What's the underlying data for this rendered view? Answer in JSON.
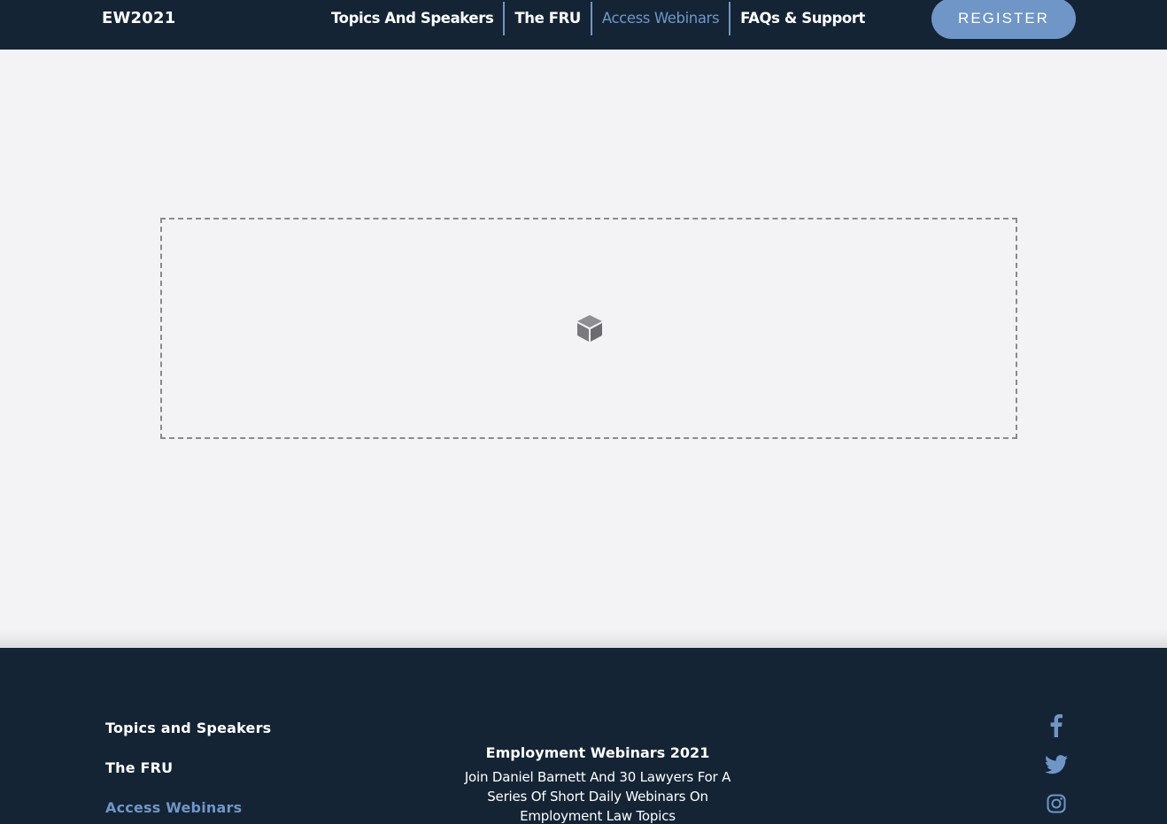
{
  "header": {
    "logo": "EW2021",
    "nav": [
      {
        "label": "Topics And Speakers"
      },
      {
        "label": "The FRU"
      },
      {
        "label": "Access Webinars",
        "active": true
      },
      {
        "label": "FAQs & Support"
      }
    ],
    "register_label": "REGISTER"
  },
  "main": {
    "placeholder_icon": "cube-icon"
  },
  "footer": {
    "links": [
      {
        "label": "Topics and Speakers"
      },
      {
        "label": "The FRU"
      },
      {
        "label": "Access Webinars",
        "active": true
      }
    ],
    "title": "Employment Webinars 2021",
    "description": "Join Daniel Barnett And 30 Lawyers For A Series Of Short Daily Webinars On Employment Law Topics",
    "social_icons": [
      "facebook-icon",
      "twitter-icon",
      "instagram-icon"
    ]
  },
  "colors": {
    "navy": "#142435",
    "accent": "#6f96c7",
    "page_bg": "#f3f2f4"
  }
}
